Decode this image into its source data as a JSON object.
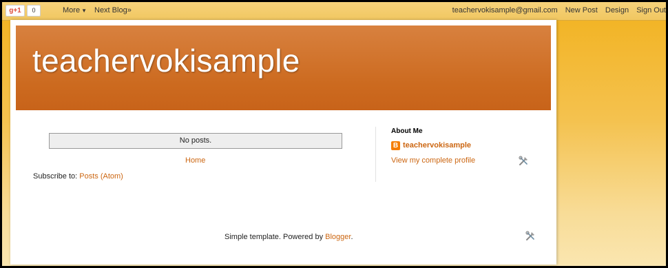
{
  "navbar": {
    "gplus_label": "g+1",
    "gplus_count": "0",
    "more_label": "More",
    "next_blog_label": "Next Blog»",
    "user_email": "teachervokisample@gmail.com",
    "new_post_label": "New Post",
    "design_label": "Design",
    "sign_out_label": "Sign Out"
  },
  "header": {
    "blog_title": "teachervokisample"
  },
  "main": {
    "no_posts_text": "No posts.",
    "home_link": "Home",
    "subscribe_prefix": "Subscribe to: ",
    "subscribe_link": "Posts (Atom)"
  },
  "sidebar": {
    "about_heading": "About Me",
    "profile_name": "teachervokisample",
    "view_profile_link": "View my complete profile"
  },
  "footer": {
    "text_prefix": "Simple template. Powered by ",
    "blogger_link": "Blogger",
    "text_suffix": "."
  },
  "icons": {
    "blogger_glyph": "B",
    "caret": "▼"
  },
  "colors": {
    "link": "#cc6611",
    "header_bg": "#cc6a1f",
    "page_bg": "#f2b21f"
  }
}
